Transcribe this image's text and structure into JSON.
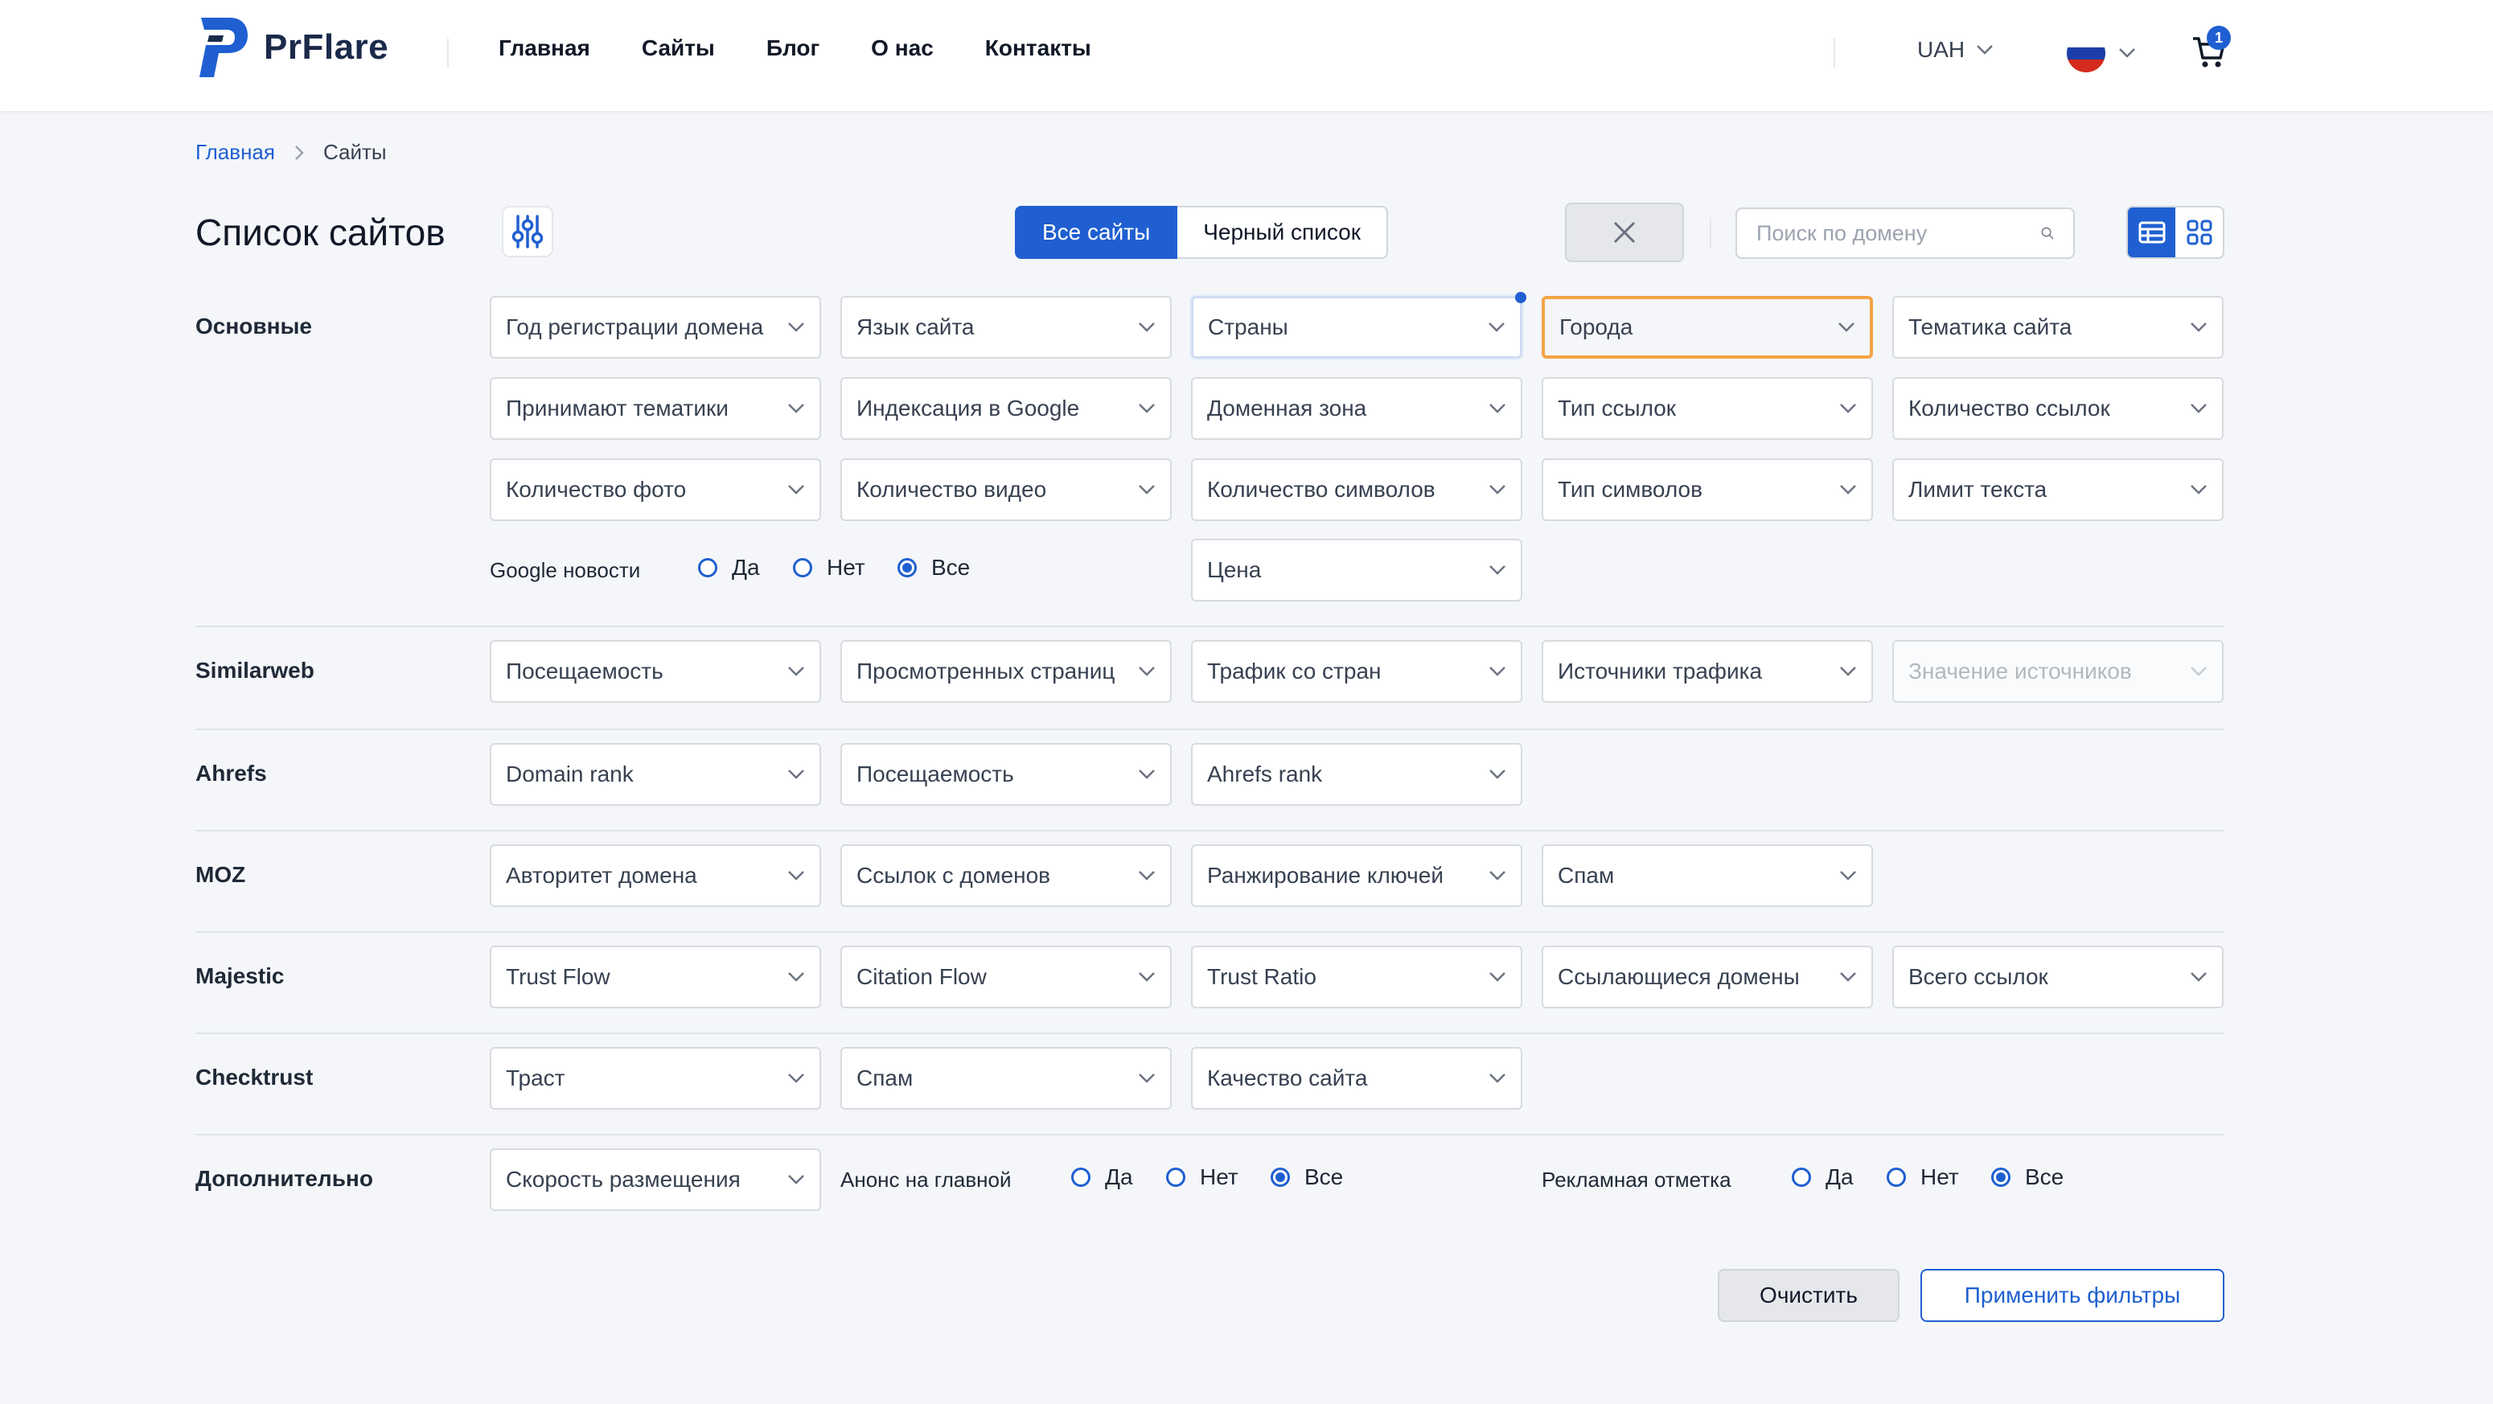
{
  "header": {
    "logo_text": "PrFlare",
    "nav": [
      "Главная",
      "Сайты",
      "Блог",
      "О нас",
      "Контакты"
    ],
    "currency": "UAH",
    "cart_count": "1"
  },
  "breadcrumb": {
    "home": "Главная",
    "current": "Сайты"
  },
  "page": {
    "title": "Список сайтов",
    "tabs": [
      "Все сайты",
      "Черный список"
    ],
    "search_placeholder": "Поиск по домену"
  },
  "sections": {
    "basic": {
      "label": "Основные",
      "row1": [
        "Год регистрации домена",
        "Язык сайта",
        "Страны",
        "Города",
        "Тематика сайта"
      ],
      "row2": [
        "Принимают тематики",
        "Индексация в Google",
        "Доменная зона",
        "Тип ссылок",
        "Количество ссылок"
      ],
      "row3": [
        "Количество фото",
        "Количество видео",
        "Количество символов",
        "Тип символов",
        "Лимит текста"
      ],
      "google_news_label": "Google новости",
      "price": "Цена"
    },
    "similarweb": {
      "label": "Similarweb",
      "items": [
        "Посещаемость",
        "Просмотренных страниц",
        "Трафик со стран",
        "Источники трафика",
        "Значение источников"
      ]
    },
    "ahrefs": {
      "label": "Ahrefs",
      "items": [
        "Domain rank",
        "Посещаемость",
        "Ahrefs rank"
      ]
    },
    "moz": {
      "label": "MOZ",
      "items": [
        "Авторитет домена",
        "Ссылок с доменов",
        "Ранжирование ключей",
        "Спам"
      ]
    },
    "majestic": {
      "label": "Majestic",
      "items": [
        "Trust Flow",
        "Citation Flow",
        "Trust Ratio",
        "Ссылающиеся домены",
        "Всего ссылок"
      ]
    },
    "checktrust": {
      "label": "Checktrust",
      "items": [
        "Траст",
        "Спам",
        "Качество сайта"
      ]
    },
    "extra": {
      "label": "Дополнительно",
      "speed": "Скорость размещения",
      "announce_label": "Анонс на главной",
      "ad_label": "Рекламная отметка"
    }
  },
  "radio_options": [
    "Да",
    "Нет",
    "Все"
  ],
  "radio_selected": "Все",
  "buttons": {
    "clear": "Очистить",
    "apply": "Применить фильтры"
  },
  "colors": {
    "accent": "#1f5fd1",
    "hover_border": "#f4a444"
  }
}
